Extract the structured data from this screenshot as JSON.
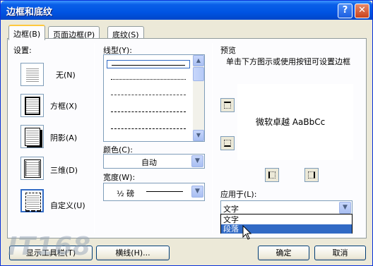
{
  "window": {
    "title": "边框和底纹",
    "help_glyph": "?",
    "close_glyph": "✕"
  },
  "tabs": [
    {
      "label": "边框(B)",
      "active": true
    },
    {
      "label": "页面边框(P)",
      "active": false
    },
    {
      "label": "底纹(S)",
      "active": false
    }
  ],
  "settings": {
    "heading": "设置:",
    "items": [
      {
        "label": "无(N)",
        "icon": "none-border-icon"
      },
      {
        "label": "方框(X)",
        "icon": "box-border-icon"
      },
      {
        "label": "阴影(A)",
        "icon": "shadow-border-icon"
      },
      {
        "label": "三维(D)",
        "icon": "3d-border-icon"
      },
      {
        "label": "自定义(U)",
        "icon": "custom-border-icon"
      }
    ]
  },
  "line_style": {
    "label": "线型(Y):"
  },
  "color": {
    "label": "颜色(C):",
    "value": "自动"
  },
  "width": {
    "label": "宽度(W):",
    "value": "½ 磅"
  },
  "preview": {
    "heading": "预览",
    "hint": "单击下方图示或使用按钮可设置边框",
    "sample_text": "微软卓越  AaBbCc"
  },
  "apply_to": {
    "label": "应用于(L):",
    "value": "文字",
    "options": [
      "文字",
      "段落"
    ],
    "highlighted": "段落"
  },
  "buttons": {
    "toolbar": "显示工具栏(T)",
    "hline": "横线(H)...",
    "ok": "确定",
    "cancel": "取消"
  },
  "watermark": "IT168",
  "colors": {
    "titlebar": "#0054e3",
    "highlight": "#316ac5",
    "dialog_bg": "#ece9d8"
  }
}
